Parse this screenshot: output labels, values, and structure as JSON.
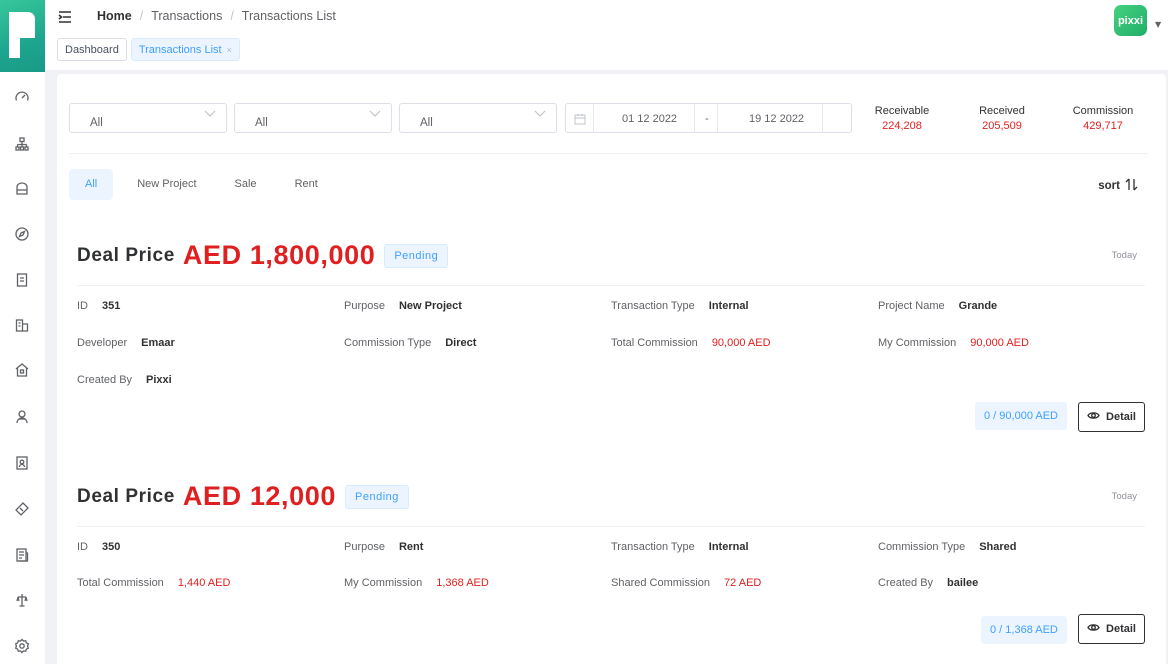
{
  "header": {
    "breadcrumb": [
      "Home",
      "Transactions",
      "Transactions List"
    ],
    "avatar_text": "pixxi",
    "tags": [
      {
        "label": "Dashboard",
        "active": false
      },
      {
        "label": "Transactions List",
        "active": true,
        "close": "×"
      }
    ]
  },
  "sidebar": {
    "icons": [
      "dashboard-icon",
      "organization-icon",
      "store-icon",
      "compass-icon",
      "document-icon",
      "building-icon",
      "home-icon",
      "users-icon",
      "contact-card-icon",
      "ticket-icon",
      "report-icon",
      "balance-icon",
      "settings-icon"
    ]
  },
  "filters": {
    "selects": [
      "All",
      "All",
      "All"
    ],
    "date_start": "01 12 2022",
    "date_separator": "-",
    "date_end": "19 12 2022"
  },
  "stats": [
    {
      "label": "Receivable",
      "value": "224,208"
    },
    {
      "label": "Received",
      "value": "205,509"
    },
    {
      "label": "Commission",
      "value": "429,717"
    }
  ],
  "tabs": [
    "All",
    "New Project",
    "Sale",
    "Rent"
  ],
  "sort_label": "sort",
  "deals": [
    {
      "title": "Deal Price",
      "amount": "AED 1,800,000",
      "status": "Pending",
      "date": "Today",
      "fields": [
        {
          "k": "ID",
          "v": "351"
        },
        {
          "k": "Purpose",
          "v": "New Project"
        },
        {
          "k": "Transaction Type",
          "v": "Internal"
        },
        {
          "k": "Project Name",
          "v": "Grande"
        },
        {
          "k": "Developer",
          "v": "Emaar"
        },
        {
          "k": "Commission Type",
          "v": "Direct"
        },
        {
          "k": "Total Commission",
          "v": "90,000 AED"
        },
        {
          "k": "My Commission",
          "v": "90,000 AED"
        },
        {
          "k": "Created By",
          "v": "Pixxi"
        }
      ],
      "progress": "0 / 90,000 AED",
      "detail_label": "Detail"
    },
    {
      "title": "Deal Price",
      "amount": "AED 12,000",
      "status": "Pending",
      "date": "Today",
      "fields": [
        {
          "k": "ID",
          "v": "350"
        },
        {
          "k": "Purpose",
          "v": "Rent"
        },
        {
          "k": "Transaction Type",
          "v": "Internal"
        },
        {
          "k": "Commission Type",
          "v": "Shared"
        },
        {
          "k": "Total Commission",
          "v": "1,440 AED"
        },
        {
          "k": "My Commission",
          "v": "1,368 AED"
        },
        {
          "k": "Shared Commission",
          "v": "72 AED"
        },
        {
          "k": "Created By",
          "v": "bailee"
        }
      ],
      "progress": "0 / 1,368 AED",
      "detail_label": "Detail"
    }
  ],
  "colors": {
    "brand": "#1fae6a",
    "accent": "#409eff",
    "amount_red": "#e02020"
  }
}
